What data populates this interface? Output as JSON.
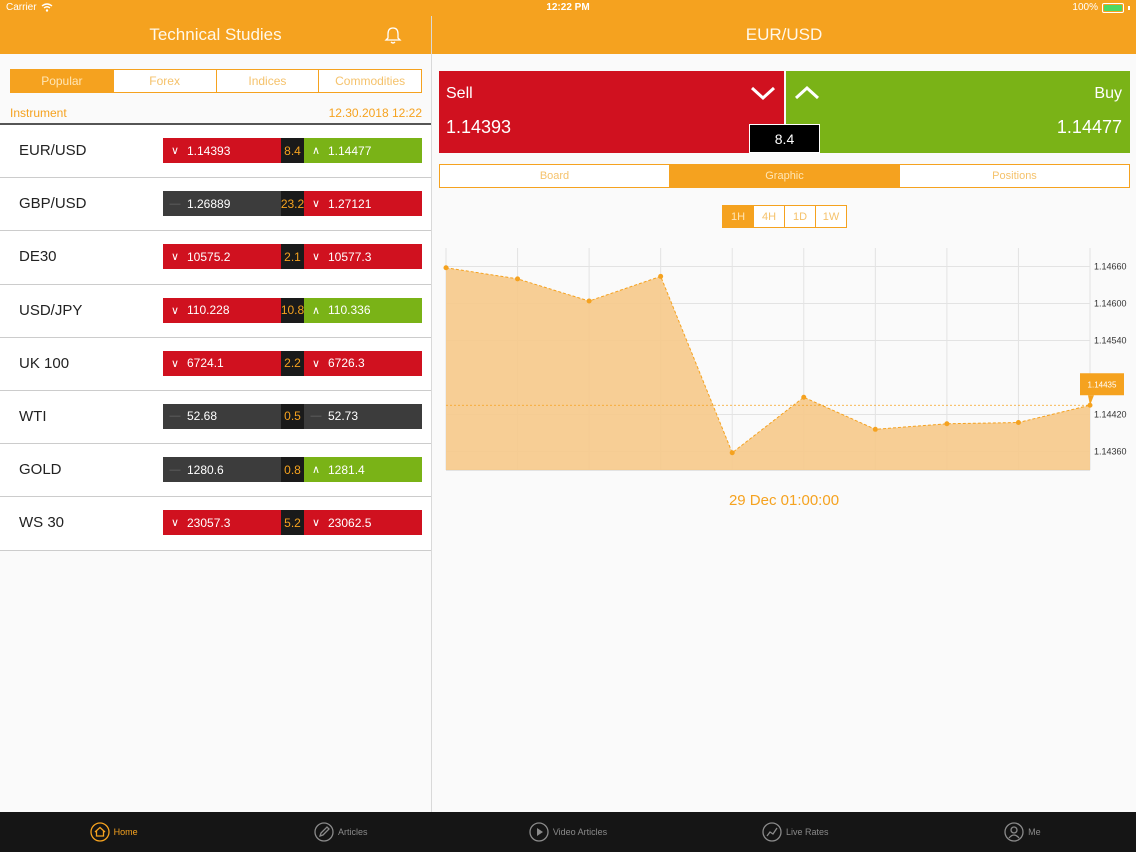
{
  "status_bar": {
    "carrier": "Carrier",
    "time": "12:22 PM",
    "battery": "100%"
  },
  "left_header": {
    "title": "Technical Studies",
    "icon": "bell-icon"
  },
  "right_header": {
    "title": "EUR/USD"
  },
  "category_tabs": [
    {
      "label": "Popular",
      "active": true
    },
    {
      "label": "Forex",
      "active": false
    },
    {
      "label": "Indices",
      "active": false
    },
    {
      "label": "Commodities",
      "active": false
    }
  ],
  "instrument_header": {
    "label": "Instrument",
    "datetime": "12.30.2018 12:22"
  },
  "instruments": [
    {
      "name": "EUR/USD",
      "bid": "1.14393",
      "bid_dir": "down",
      "spread": "8.4",
      "ask": "1.14477",
      "ask_dir": "up"
    },
    {
      "name": "GBP/USD",
      "bid": "1.26889",
      "bid_dir": "flat",
      "spread": "23.2",
      "ask": "1.27121",
      "ask_dir": "down"
    },
    {
      "name": "DE30",
      "bid": "10575.2",
      "bid_dir": "down",
      "spread": "2.1",
      "ask": "10577.3",
      "ask_dir": "down"
    },
    {
      "name": "USD/JPY",
      "bid": "110.228",
      "bid_dir": "down",
      "spread": "10.8",
      "ask": "110.336",
      "ask_dir": "up"
    },
    {
      "name": "UK 100",
      "bid": "6724.1",
      "bid_dir": "down",
      "spread": "2.2",
      "ask": "6726.3",
      "ask_dir": "down"
    },
    {
      "name": "WTI",
      "bid": "52.68",
      "bid_dir": "flat",
      "spread": "0.5",
      "ask": "52.73",
      "ask_dir": "flat"
    },
    {
      "name": "GOLD",
      "bid": "1280.6",
      "bid_dir": "flat",
      "spread": "0.8",
      "ask": "1281.4",
      "ask_dir": "up"
    },
    {
      "name": "WS 30",
      "bid": "23057.3",
      "bid_dir": "down",
      "spread": "5.2",
      "ask": "23062.5",
      "ask_dir": "down"
    }
  ],
  "trade": {
    "sell_label": "Sell",
    "sell_price": "1.14393",
    "buy_label": "Buy",
    "buy_price": "1.14477",
    "spread": "8.4"
  },
  "view_tabs": [
    {
      "label": "Board",
      "active": false
    },
    {
      "label": "Graphic",
      "active": true
    },
    {
      "label": "Positions",
      "active": false
    }
  ],
  "period_tabs": [
    {
      "label": "1H",
      "active": true
    },
    {
      "label": "4H",
      "active": false
    },
    {
      "label": "1D",
      "active": false
    },
    {
      "label": "1W",
      "active": false
    }
  ],
  "chart_data": {
    "type": "area",
    "x": [
      0,
      1,
      2,
      3,
      4,
      5,
      6,
      7,
      8,
      9
    ],
    "values": [
      1.14658,
      1.1464,
      1.14604,
      1.14644,
      1.14358,
      1.14448,
      1.14396,
      1.14405,
      1.14407,
      1.14435
    ],
    "ylim": [
      1.1433,
      1.1469
    ],
    "y_ticks": [
      "1.14660",
      "1.14600",
      "1.14540",
      "1.14420",
      "1.14360"
    ],
    "y_tick_values": [
      1.1466,
      1.146,
      1.1454,
      1.1442,
      1.1436
    ],
    "last_value_label": "1.14435",
    "grid": true,
    "date_label": "29 Dec 01:00:00",
    "colors": {
      "fill": "#f6c98a",
      "line": "#f5a21f",
      "grid": "#e3e3e3"
    }
  },
  "tab_bar": [
    {
      "label": "Home",
      "icon": "home-icon",
      "active": true
    },
    {
      "label": "Articles",
      "icon": "pencil-icon",
      "active": false
    },
    {
      "label": "Video Articles",
      "icon": "play-icon",
      "active": false
    },
    {
      "label": "Live Rates",
      "icon": "chart-icon",
      "active": false
    },
    {
      "label": "Me",
      "icon": "user-icon",
      "active": false
    }
  ],
  "colors": {
    "accent": "#f5a21f",
    "sell": "#d0111f",
    "buy": "#7ab317",
    "neutral": "#3c3c3c"
  }
}
